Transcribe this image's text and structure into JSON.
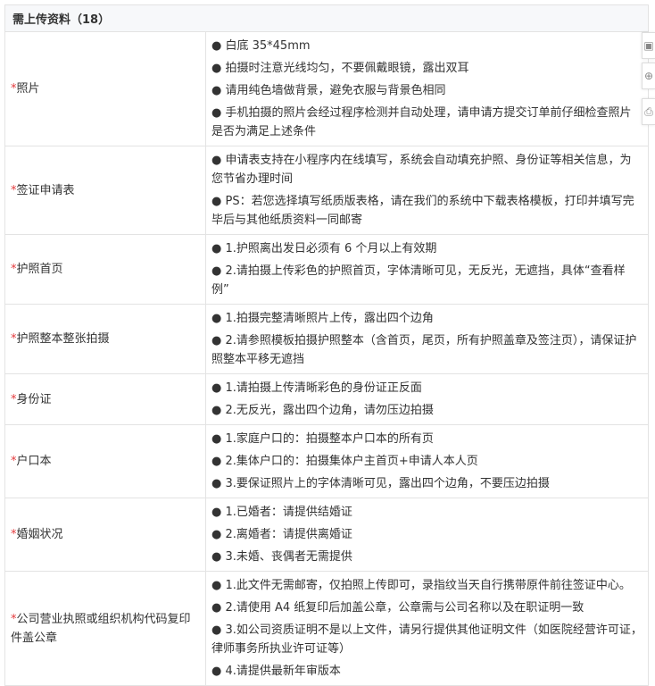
{
  "header": "需上传资料（18）",
  "rows": [
    {
      "label": "照片",
      "items": [
        "● 白底  35*45mm",
        "● 拍摄时注意光线均匀，不要佩戴眼镜，露出双耳",
        "● 请用纯色墙做背景，避免衣服与背景色相同",
        "● 手机拍摄的照片会经过程序检测并自动处理，请申请方提交订单前仔细检查照片是否为满足上述条件"
      ]
    },
    {
      "label": "签证申请表",
      "items": [
        "● 申请表支持在小程序内在线填写，系统会自动填充护照、身份证等相关信息，为您节省办理时间",
        "● PS：若您选择填写纸质版表格，请在我们的系统中下载表格模板，打印并填写完毕后与其他纸质资料一同邮寄"
      ]
    },
    {
      "label": "护照首页",
      "items": [
        "● 1.护照离出发日必须有 6 个月以上有效期",
        "● 2.请拍摄上传彩色的护照首页，字体清晰可见，无反光，无遮挡，具体“查看样例”"
      ]
    },
    {
      "label": "护照整本整张拍摄",
      "items": [
        "● 1.拍摄完整清晰照片上传，露出四个边角",
        "● 2.请参照模板拍摄护照整本（含首页，尾页，所有护照盖章及签注页），请保证护照整本平移无遮挡"
      ]
    },
    {
      "label": "身份证",
      "items": [
        "● 1.请拍摄上传清晰彩色的身份证正反面",
        "● 2.无反光，露出四个边角，请勿压边拍摄"
      ]
    },
    {
      "label": "户口本",
      "items": [
        "● 1.家庭户口的：拍摄整本户口本的所有页",
        "● 2.集体户口的：拍摄集体户主首页+申请人本人页",
        "● 3.要保证照片上的字体清晰可见，露出四个边角，不要压边拍摄"
      ]
    },
    {
      "label": "婚姻状况",
      "items": [
        "● 1.已婚者：请提供结婚证",
        "● 2.离婚者：请提供离婚证",
        "● 3.未婚、丧偶者无需提供"
      ]
    },
    {
      "label": "公司营业执照或组织机构代码复印件盖公章",
      "items": [
        "● 1.此文件无需邮寄，仅拍照上传即可，录指纹当天自行携带原件前往签证中心。",
        "● 2.请使用 A4 纸复印后加盖公章，公章需与公司名称以及在职证明一致",
        "● 3.如公司资质证明不是以上文件，请另行提供其他证明文件（如医院经营许可证，律师事务所执业许可证等）",
        "● 4.请提供最新年审版本"
      ]
    }
  ],
  "required_mark": "*"
}
